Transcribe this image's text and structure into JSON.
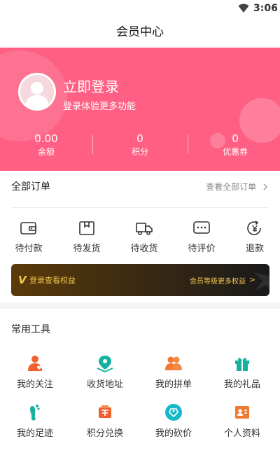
{
  "status_bar": {
    "time": "3:06",
    "icons": [
      "wifi-icon"
    ]
  },
  "header": {
    "title": "会员中心"
  },
  "profile": {
    "login_title": "立即登录",
    "login_subtitle": "登录体验更多功能",
    "avatar_icon": "avatar-placeholder-icon",
    "stats": [
      {
        "value": "0.00",
        "label": "余额"
      },
      {
        "value": "0",
        "label": "积分"
      },
      {
        "value": "0",
        "label": "优惠券"
      }
    ]
  },
  "orders": {
    "title": "全部订单",
    "view_all": "查看全部订单",
    "items": [
      {
        "label": "待付款",
        "icon": "wallet-icon"
      },
      {
        "label": "待发货",
        "icon": "package-icon"
      },
      {
        "label": "待收货",
        "icon": "truck-icon"
      },
      {
        "label": "待评价",
        "icon": "comment-icon"
      },
      {
        "label": "退款",
        "icon": "refund-icon"
      }
    ]
  },
  "vip": {
    "logo": "V",
    "left_text": "登录查看权益",
    "right_text": "会员等级更多权益",
    "arrow": ">",
    "colors": {
      "gold": "#f4c64e",
      "bg_start": "#5a3a0a",
      "bg_end": "#1a1a1a"
    }
  },
  "tools": {
    "title": "常用工具",
    "items": [
      {
        "label": "我的关注",
        "icon": "follow-icon",
        "color": "#f0612f"
      },
      {
        "label": "收货地址",
        "icon": "address-icon",
        "color": "#14b29e"
      },
      {
        "label": "我的拼单",
        "icon": "group-buy-icon",
        "color": "#f07a2f"
      },
      {
        "label": "我的礼品",
        "icon": "gift-icon",
        "color": "#14b29e"
      },
      {
        "label": "我的足迹",
        "icon": "footprint-icon",
        "color": "#14b29e"
      },
      {
        "label": "积分兑换",
        "icon": "points-exchange-icon",
        "color": "#f0612f"
      },
      {
        "label": "我的砍价",
        "icon": "bargain-icon",
        "color": "#14b8c8"
      },
      {
        "label": "个人资料",
        "icon": "profile-card-icon",
        "color": "#f07a2f"
      }
    ]
  },
  "colors": {
    "brand_pink": "#fe5f82"
  }
}
